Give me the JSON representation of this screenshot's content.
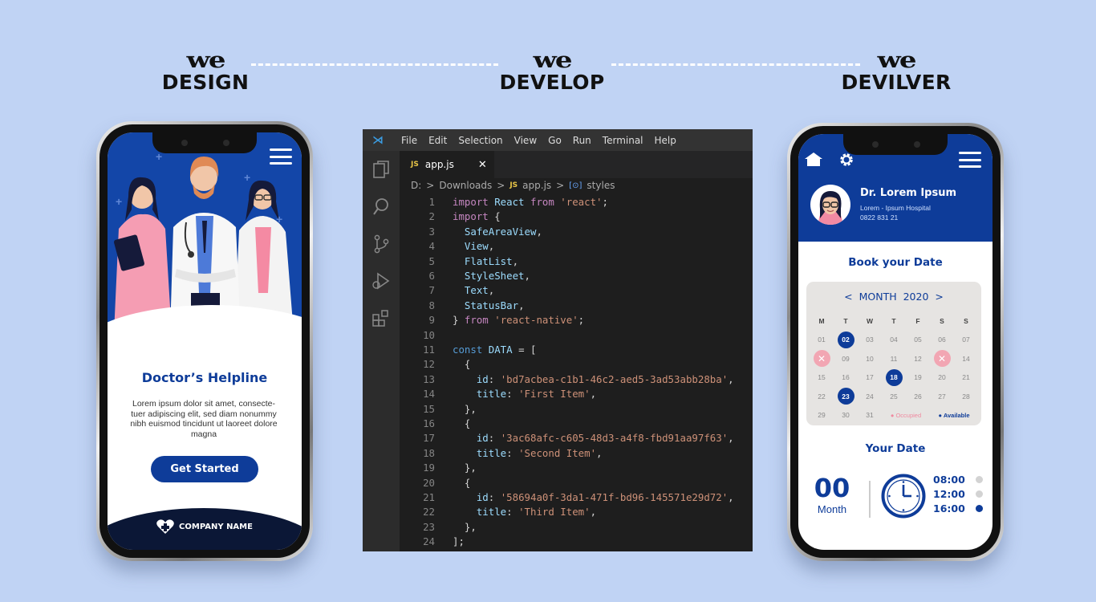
{
  "stages": [
    {
      "brand": "we",
      "label": "DESIGN"
    },
    {
      "brand": "we",
      "label": "DEVELOP"
    },
    {
      "brand": "we",
      "label": "DEVILVER"
    }
  ],
  "left_phone": {
    "title": "Doctor’s Helpline",
    "body": "Lorem ipsum dolor sit amet, consecte-tuer adipiscing elit, sed diam nonummy nibh euismod tincidunt ut laoreet dolore magna",
    "button": "Get Started",
    "company": "COMPANY NAME"
  },
  "editor": {
    "menu": [
      "File",
      "Edit",
      "Selection",
      "View",
      "Go",
      "Run",
      "Terminal",
      "Help"
    ],
    "tab": {
      "js_badge": "JS",
      "filename": "app.js",
      "close": "✕"
    },
    "breadcrumb": {
      "drive": "D:",
      "sep": ">",
      "folder": "Downloads",
      "js_badge": "JS",
      "file": "app.js",
      "symbol_badge": "[⊙]",
      "symbol": "styles"
    },
    "lines": [
      {
        "n": "1",
        "t": [
          [
            "kw",
            "import "
          ],
          [
            "var",
            "React "
          ],
          [
            "kw",
            "from "
          ],
          [
            "str",
            "'react'"
          ],
          [
            "",
            "; "
          ]
        ]
      },
      {
        "n": "2",
        "t": [
          [
            "kw",
            "import "
          ],
          [
            "",
            "{"
          ]
        ]
      },
      {
        "n": "3",
        "t": [
          [
            "var",
            "  SafeAreaView"
          ],
          [
            "",
            ","
          ]
        ]
      },
      {
        "n": "4",
        "t": [
          [
            "var",
            "  View"
          ],
          [
            "",
            ","
          ]
        ]
      },
      {
        "n": "5",
        "t": [
          [
            "var",
            "  FlatList"
          ],
          [
            "",
            ","
          ]
        ]
      },
      {
        "n": "6",
        "t": [
          [
            "var",
            "  StyleSheet"
          ],
          [
            "",
            ","
          ]
        ]
      },
      {
        "n": "7",
        "t": [
          [
            "var",
            "  Text"
          ],
          [
            "",
            ","
          ]
        ]
      },
      {
        "n": "8",
        "t": [
          [
            "var",
            "  StatusBar"
          ],
          [
            "",
            ","
          ]
        ]
      },
      {
        "n": "9",
        "t": [
          [
            "",
            "} "
          ],
          [
            "kw",
            "from "
          ],
          [
            "str",
            "'react-native'"
          ],
          [
            "",
            ";"
          ]
        ]
      },
      {
        "n": "10",
        "t": []
      },
      {
        "n": "11",
        "t": [
          [
            "kb",
            "const "
          ],
          [
            "var",
            "DATA "
          ],
          [
            "",
            "= ["
          ]
        ]
      },
      {
        "n": "12",
        "t": [
          [
            "",
            "  {"
          ]
        ]
      },
      {
        "n": "13",
        "t": [
          [
            "var",
            "    id"
          ],
          [
            "",
            ": "
          ],
          [
            "str",
            "'bd7acbea-c1b1-46c2-aed5-3ad53abb28ba'"
          ],
          [
            "",
            ","
          ]
        ]
      },
      {
        "n": "14",
        "t": [
          [
            "var",
            "    title"
          ],
          [
            "",
            ": "
          ],
          [
            "str",
            "'First Item'"
          ],
          [
            "",
            ","
          ]
        ]
      },
      {
        "n": "15",
        "t": [
          [
            "",
            "  },"
          ]
        ]
      },
      {
        "n": "16",
        "t": [
          [
            "",
            "  {"
          ]
        ]
      },
      {
        "n": "17",
        "t": [
          [
            "var",
            "    id"
          ],
          [
            "",
            ": "
          ],
          [
            "str",
            "'3ac68afc-c605-48d3-a4f8-fbd91aa97f63'"
          ],
          [
            "",
            ","
          ]
        ]
      },
      {
        "n": "18",
        "t": [
          [
            "var",
            "    title"
          ],
          [
            "",
            ": "
          ],
          [
            "str",
            "'Second Item'"
          ],
          [
            "",
            ","
          ]
        ]
      },
      {
        "n": "19",
        "t": [
          [
            "",
            "  },"
          ]
        ]
      },
      {
        "n": "20",
        "t": [
          [
            "",
            "  {"
          ]
        ]
      },
      {
        "n": "21",
        "t": [
          [
            "var",
            "    id"
          ],
          [
            "",
            ": "
          ],
          [
            "str",
            "'58694a0f-3da1-471f-bd96-145571e29d72'"
          ],
          [
            "",
            ","
          ]
        ]
      },
      {
        "n": "22",
        "t": [
          [
            "var",
            "    title"
          ],
          [
            "",
            ": "
          ],
          [
            "str",
            "'Third Item'"
          ],
          [
            "",
            ","
          ]
        ]
      },
      {
        "n": "23",
        "t": [
          [
            "",
            "  },"
          ]
        ]
      },
      {
        "n": "24",
        "t": [
          [
            "",
            "];"
          ]
        ]
      }
    ]
  },
  "right_phone": {
    "doctor_name": "Dr. Lorem Ipsum",
    "hospital": "Lorem - Ipsum Hospital",
    "phone": "0822 831 21",
    "book_title": "Book your Date",
    "calendar": {
      "prev": "<",
      "month": "MONTH",
      "year": "2020",
      "next": ">",
      "weekdays": [
        "M",
        "T",
        "W",
        "T",
        "F",
        "S",
        "S"
      ],
      "days": [
        [
          "01",
          "02",
          "03",
          "04",
          "05",
          "06",
          "07"
        ],
        [
          "08",
          "09",
          "10",
          "11",
          "12",
          "13",
          "14"
        ],
        [
          "15",
          "16",
          "17",
          "18",
          "19",
          "20",
          "21"
        ],
        [
          "22",
          "23",
          "24",
          "25",
          "26",
          "27",
          "28"
        ],
        [
          "29",
          "30",
          "31"
        ]
      ],
      "available": [
        "02",
        "18",
        "23"
      ],
      "occupied": [
        "08",
        "13"
      ],
      "legend_occupied": "Occupied",
      "legend_available": "Available"
    },
    "your_date_title": "Your Date",
    "big_number": "00",
    "big_label": "Month",
    "times": [
      {
        "time": "08:00",
        "active": false
      },
      {
        "time": "12:00",
        "active": false
      },
      {
        "time": "16:00",
        "active": true
      }
    ]
  },
  "colors": {
    "background": "#c0d3f4",
    "brand_blue": "#0e3c99",
    "occupied_pink": "#f2a6b3",
    "editor_bg": "#1e1e1e"
  }
}
